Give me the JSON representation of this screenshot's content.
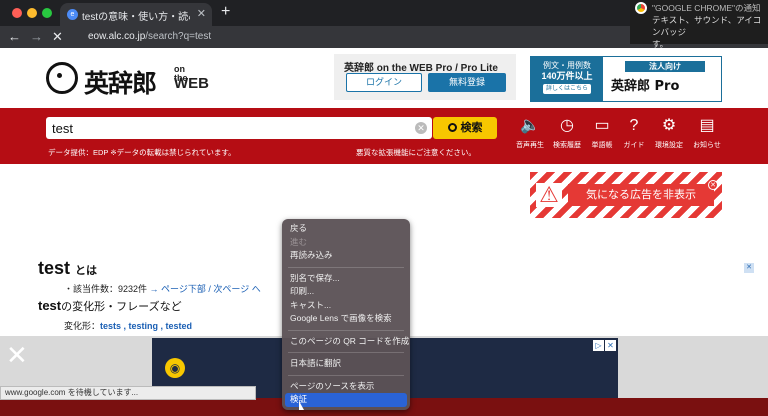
{
  "browser": {
    "tab_title": "testの意味・使い方・読み方 | 英辞",
    "tab_close": "✕",
    "new_tab": "+",
    "url_host": "eow.alc.co.jp",
    "url_path": "/search?q=test"
  },
  "notification": {
    "title": "\"GOOGLE CHROME\"の通知",
    "body": "テキスト、サウンド、アイコンバッジ",
    "body2": "す。"
  },
  "header": {
    "logo_text": "英辞郎",
    "logo_on_the": "on the",
    "logo_web": "WEB",
    "pro_title": "英辞郎 on the WEB Pro / Pro Lite",
    "login_label": "ログイン",
    "register_label": "無料登録",
    "banner_line1": "例文・用例数",
    "banner_line2": "140万件以上",
    "banner_small": "詳しくはこちら",
    "banner_corp": "法人向け",
    "banner_brand": "英辞郎 Pro"
  },
  "search": {
    "value": "test",
    "button_label": "検索",
    "clear_label": "✕",
    "data_note": "データ提供：EDP ※データの転載は禁じられています。",
    "warn_note": "悪質な拡張機能にご注意ください。",
    "tools": [
      {
        "label": "音声再生",
        "icon": "speaker-icon",
        "glyph": "🔈"
      },
      {
        "label": "検索履歴",
        "icon": "clock-icon",
        "glyph": "◷"
      },
      {
        "label": "単語帳",
        "icon": "monitor-icon",
        "glyph": "▭"
      },
      {
        "label": "ガイド",
        "icon": "help-icon",
        "glyph": "?"
      },
      {
        "label": "環境設定",
        "icon": "gear-icon",
        "glyph": "⚙"
      },
      {
        "label": "お知らせ",
        "icon": "notice-icon",
        "glyph": "▤"
      }
    ]
  },
  "ad_box": {
    "label": "気になる広告を非表示",
    "warn": "⚠",
    "close": "✕"
  },
  "result": {
    "word": "test",
    "word_suffix": "とは",
    "count_text": "・該当件数：9232件",
    "page_bottom": "→ ページ下部",
    "next_page": "/ 次ページ へ",
    "forms_word": "test",
    "forms_suffix": "の変化形・フレーズなど",
    "forms_label": "変化形：",
    "forms_values": "tests , testing , tested",
    "side_close": "✕"
  },
  "bottom_ad": {
    "close": "✕",
    "info": "▷",
    "x": "✕",
    "logo": "◉"
  },
  "status_text": "www.google.com を待機しています...",
  "context_menu": {
    "items": [
      {
        "label": "戻る",
        "disabled": false
      },
      {
        "label": "進む",
        "disabled": true
      },
      {
        "label": "再読み込み",
        "disabled": false
      },
      {
        "sep": true
      },
      {
        "label": "別名で保存...",
        "disabled": false
      },
      {
        "label": "印刷...",
        "disabled": false
      },
      {
        "label": "キャスト...",
        "disabled": false
      },
      {
        "label": "Google Lens で画像を検索",
        "disabled": false
      },
      {
        "sep": true
      },
      {
        "label": "このページの QR コードを作成",
        "disabled": false
      },
      {
        "sep": true
      },
      {
        "label": "日本語に翻訳",
        "disabled": false
      },
      {
        "sep": true
      },
      {
        "label": "ページのソースを表示",
        "disabled": false
      },
      {
        "label": "検証",
        "disabled": false,
        "selected": true
      }
    ]
  }
}
